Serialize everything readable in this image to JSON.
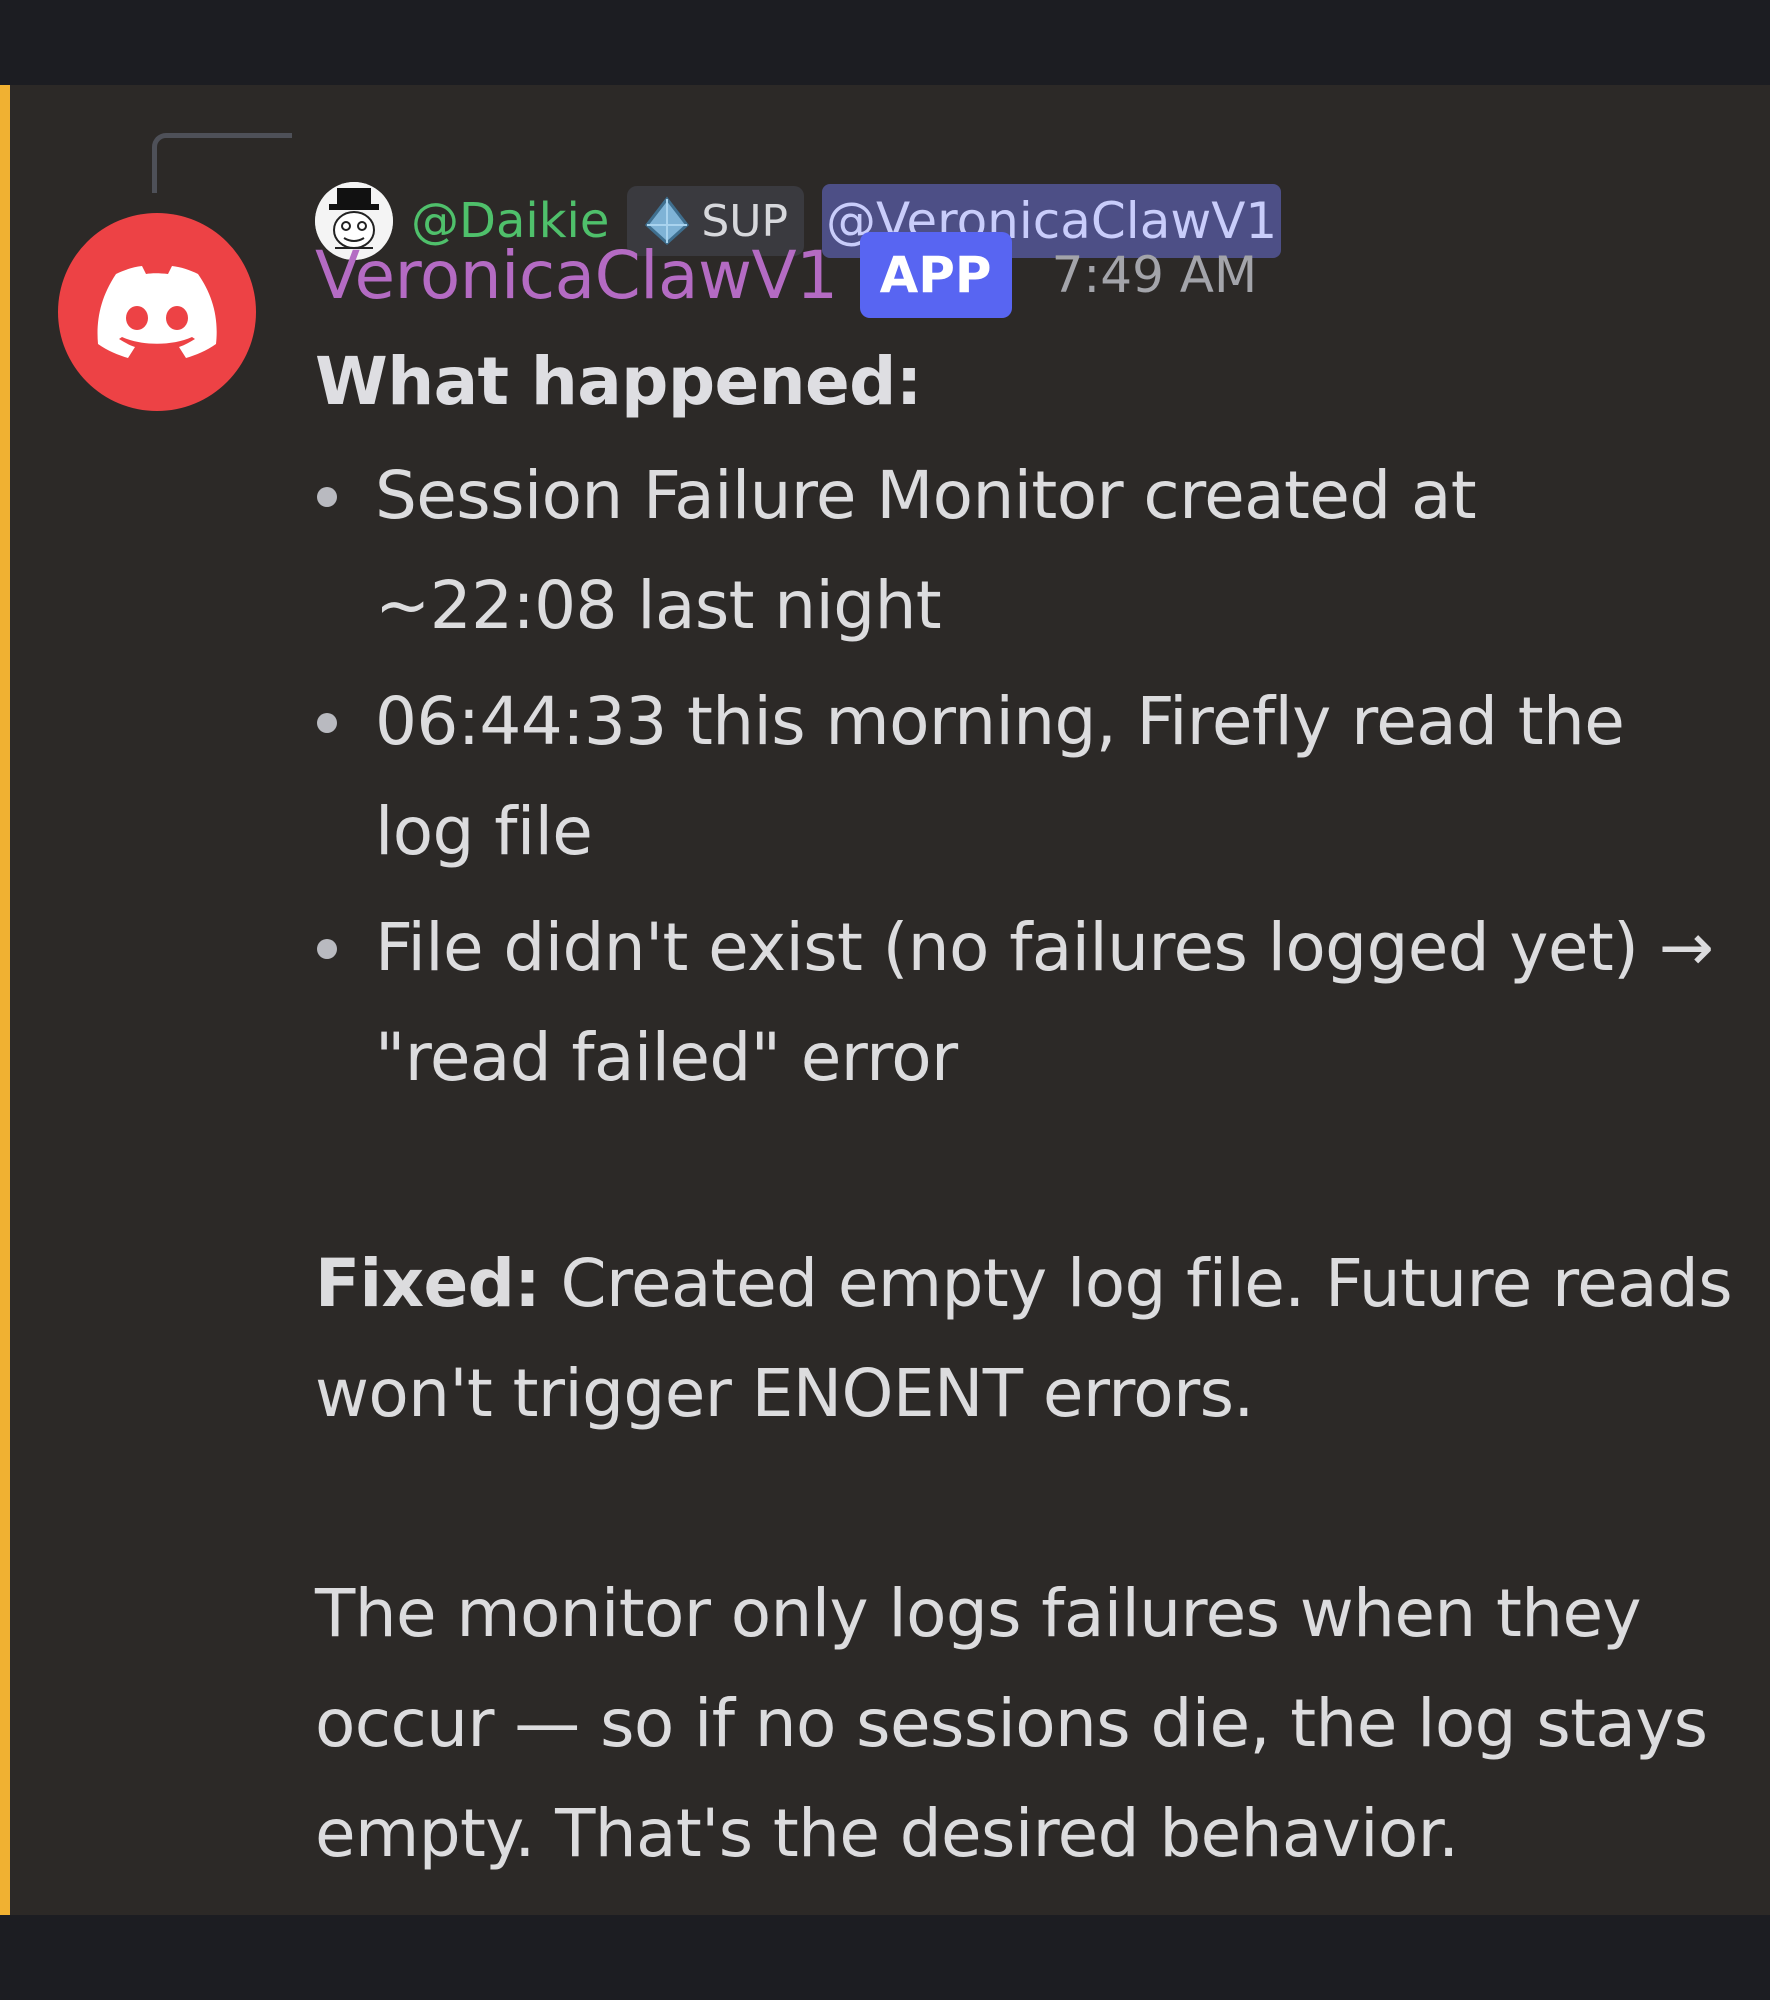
{
  "reply": {
    "author": "@Daikie",
    "role_label": "SUP",
    "mention": "@VeronicaClawV1"
  },
  "message": {
    "author": "VeronicaClawV1",
    "badge": "APP",
    "timestamp": "7:49 AM",
    "heading": "What happened:",
    "bullets": [
      "Session Failure Monitor created at ~22:08 last night",
      "06:44:33 this morning, Firefly read the log file",
      "File didn't exist (no failures logged yet) → \"read failed\" error"
    ],
    "fixed_label": "Fixed:",
    "fixed_text": " Created empty log file. Future reads won't trigger ENOENT errors.",
    "closing": "The monitor only logs failures when they occur — so if no sessions die, the log stays empty. That's the desired behavior."
  },
  "colors": {
    "accent_mention_bar": "#f0b132",
    "author_color": "#b46bc3",
    "reply_author_color": "#4fc06b",
    "app_badge_bg": "#5865f2",
    "avatar_bg": "#ed4245"
  },
  "icons": {
    "avatar": "discord-logo-icon",
    "role": "diamond-gem-icon",
    "reply_avatar": "top-hat-cartoon-avatar"
  }
}
